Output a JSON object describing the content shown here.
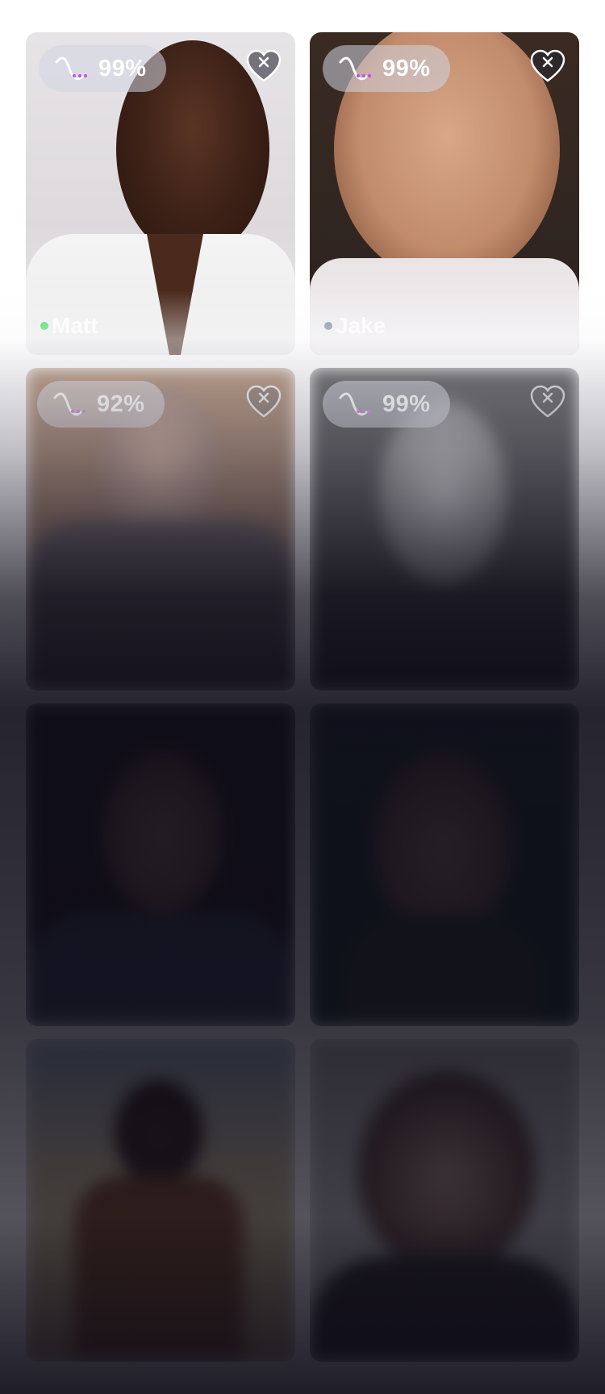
{
  "profiles": [
    {
      "name": "Matt",
      "match": "99%",
      "online": true,
      "status_color": "#3ddc5c"
    },
    {
      "name": "Jake",
      "match": "99%",
      "online": false,
      "status_color": "#7f8aa0"
    },
    {
      "name": "",
      "match": "92%"
    },
    {
      "name": "",
      "match": "99%"
    },
    {
      "name": "",
      "match": ""
    },
    {
      "name": "",
      "match": ""
    },
    {
      "name": "",
      "match": ""
    },
    {
      "name": "",
      "match": ""
    }
  ],
  "icons": {
    "match": "wave-match-icon",
    "favorite": "heart-x-icon"
  },
  "colors": {
    "accent": "#c44fe0",
    "text": "#ffffff"
  }
}
